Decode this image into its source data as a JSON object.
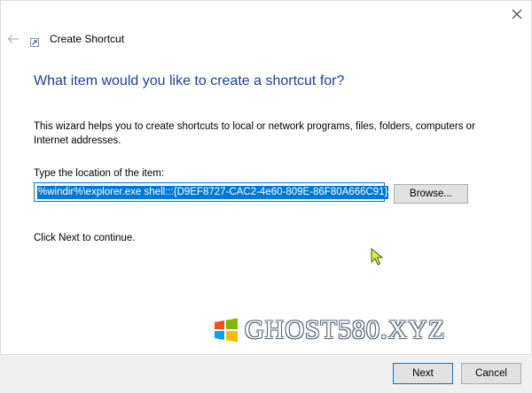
{
  "window": {
    "title": "Create Shortcut",
    "close_icon": "close-icon",
    "back_icon": "back-arrow-icon",
    "title_icon": "shortcut-icon"
  },
  "main": {
    "heading": "What item would you like to create a shortcut for?",
    "description": "This wizard helps you to create shortcuts to local or network programs, files, folders, computers or Internet addresses.",
    "location_label": "Type the location of the item:",
    "location_value": "%windir%\\explorer.exe shell:::{D9EF8727-CAC2-4e60-809E-86F80A666C91}",
    "browse_label": "Browse...",
    "continue_text": "Click Next to continue."
  },
  "watermark": {
    "text": "GHOST580.XYZ",
    "logo_colors": [
      "#f25022",
      "#7fba00",
      "#00a4ef",
      "#ffb900"
    ]
  },
  "footer": {
    "next_label": "Next",
    "cancel_label": "Cancel"
  },
  "colors": {
    "heading": "#1f3e9e",
    "accent": "#0078d7",
    "cursor": "#d6f53a"
  }
}
